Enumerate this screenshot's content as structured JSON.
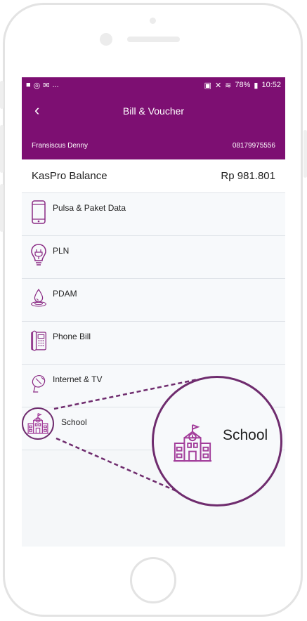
{
  "status": {
    "left_icons": [
      "camera-icon",
      "whatsapp-icon",
      "mail-icon"
    ],
    "left_more": "...",
    "battery": "78%",
    "time": "10:52"
  },
  "header": {
    "title": "Bill & Voucher",
    "user_name": "Fransiscus Denny",
    "phone": "08179975556",
    "background": "#7d0f72"
  },
  "balance": {
    "label": "KasPro Balance",
    "amount": "Rp 981.801"
  },
  "menu": [
    {
      "label": "Pulsa & Paket Data",
      "icon": "smartphone-icon"
    },
    {
      "label": "PLN",
      "icon": "lightbulb-icon"
    },
    {
      "label": "PDAM",
      "icon": "water-drop-icon"
    },
    {
      "label": "Phone Bill",
      "icon": "telephone-icon"
    },
    {
      "label": "Internet & TV",
      "icon": "satellite-dish-icon"
    },
    {
      "label": "School",
      "icon": "school-icon"
    }
  ],
  "callout": {
    "label": "School",
    "color": "#6f2c6e"
  }
}
